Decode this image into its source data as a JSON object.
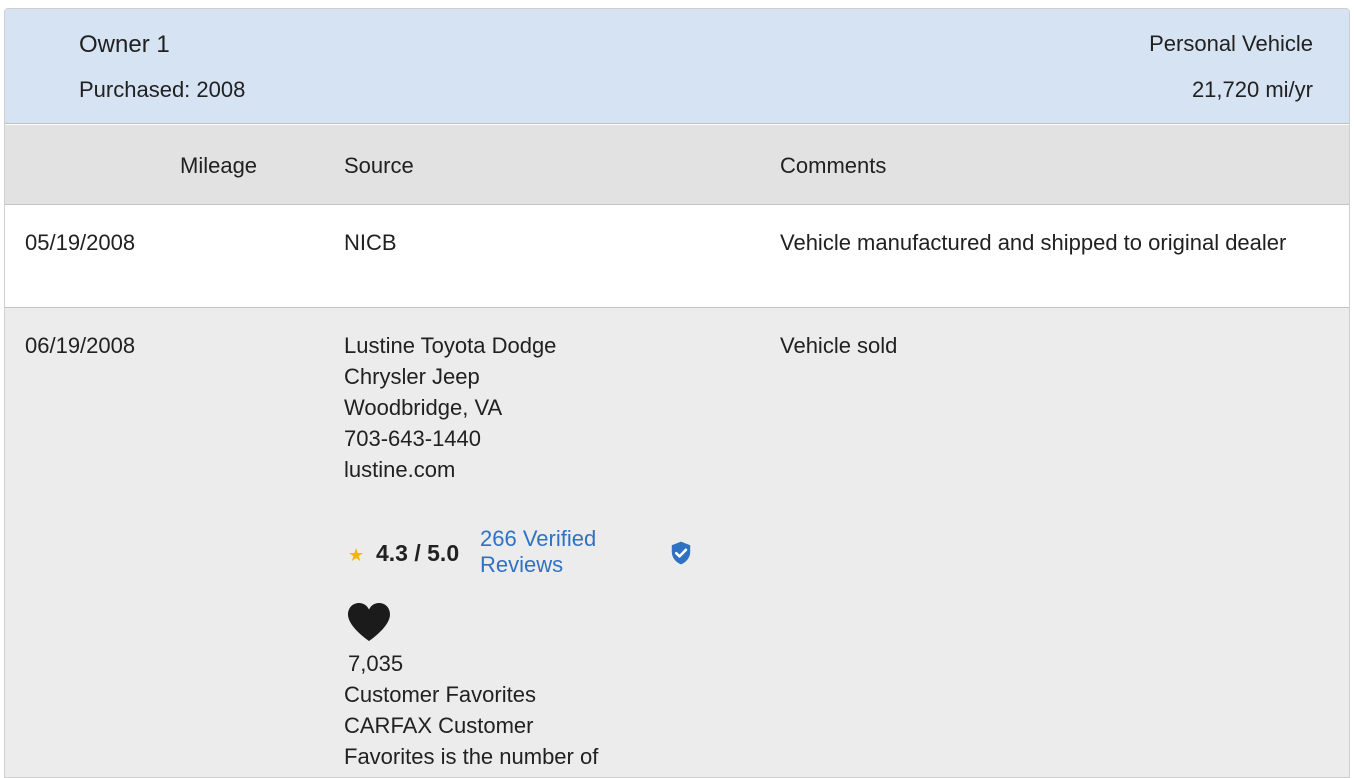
{
  "owner": {
    "title": "Owner 1",
    "purchased": "Purchased: 2008",
    "vehicle_type": "Personal Vehicle",
    "annual_miles": "21,720 mi/yr"
  },
  "columns": {
    "mileage": "Mileage",
    "source": "Source",
    "comments": "Comments"
  },
  "records": [
    {
      "date": "05/19/2008",
      "source": "NICB",
      "comment": "Vehicle manufactured and shipped to original dealer"
    },
    {
      "date": "06/19/2008",
      "source_lines": [
        "Lustine Toyota Dodge",
        "Chrysler Jeep",
        "Woodbridge, VA",
        "703-643-1440",
        "lustine.com"
      ],
      "rating": "4.3 / 5.0",
      "reviews_link": "266 Verified Reviews",
      "favorites_count": "7,035",
      "favorites_label": "Customer Favorites",
      "favorites_desc_lines": [
        "CARFAX Customer",
        "Favorites is the number of"
      ],
      "comment": "Vehicle sold"
    }
  ],
  "colors": {
    "header_bg": "#d6e3f3",
    "col_header_bg": "#e2e2e2",
    "row_alt_bg": "#ececec",
    "link": "#2f72c4",
    "star": "#f2b600",
    "badge": "#2f72c4"
  },
  "icons": [
    "star-icon",
    "verified-badge-icon",
    "heart-icon"
  ]
}
